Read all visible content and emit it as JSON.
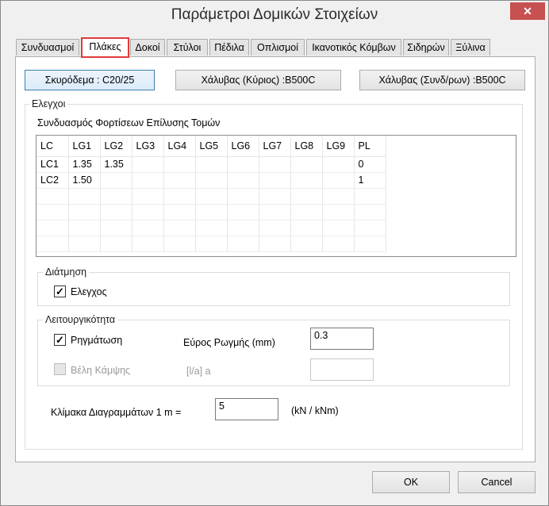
{
  "window": {
    "title": "Παράμετροι Δομικών Στοιχείων",
    "close_glyph": "✕"
  },
  "tabs": [
    {
      "label": "Συνδυασμοί"
    },
    {
      "label": "Πλάκες"
    },
    {
      "label": "Δοκοί"
    },
    {
      "label": "Στύλοι"
    },
    {
      "label": "Πέδιλα"
    },
    {
      "label": "Οπλισμοί"
    },
    {
      "label": "Ικανοτικός Κόμβων"
    },
    {
      "label": "Σιδηρών"
    },
    {
      "label": "Ξύλινα"
    }
  ],
  "active_tab": "Πλάκες",
  "materials": {
    "concrete": "Σκυρόδεμα : C20/25",
    "steel_main": "Χάλυβας  (Κύριος) :B500C",
    "steel_secondary": "Χάλυβας  (Συνδ/ρων) :B500C"
  },
  "checks": {
    "group_title": "Ελεγχοι",
    "combo_title": "Συνδυασμός Φορτίσεων Επίλυσης Τομών",
    "columns": [
      "LC",
      "LG1",
      "LG2",
      "LG3",
      "LG4",
      "LG5",
      "LG6",
      "LG7",
      "LG8",
      "LG9",
      "PL"
    ],
    "rows": [
      {
        "LC": "LC1",
        "LG1": "1.35",
        "LG2": "1.35",
        "LG3": "",
        "LG4": "",
        "LG5": "",
        "LG6": "",
        "LG7": "",
        "LG8": "",
        "LG9": "",
        "PL": "0"
      },
      {
        "LC": "LC2",
        "LG1": "1.50",
        "LG2": "",
        "LG3": "",
        "LG4": "",
        "LG5": "",
        "LG6": "",
        "LG7": "",
        "LG8": "",
        "LG9": "",
        "PL": "1"
      }
    ]
  },
  "punching": {
    "group_title": "Διάτμηση",
    "check_label": "Ελεγχος",
    "checked": true,
    "check_mark": "✓"
  },
  "serviceability": {
    "group_title": "Λειτουργικότητα",
    "cracking_label": "Ρηγμάτωση",
    "cracking_checked": true,
    "crack_width_label": "Εύρος Ρωγμής (mm)",
    "crack_width_value": "0.3",
    "deflection_label": "Βέλη Κάμψης",
    "deflection_checked": false,
    "deflection_ratio_label": "[l/a]  a",
    "deflection_ratio_value": ""
  },
  "scale": {
    "label": "Κλίμακα Διαγραμμάτων 1 m =",
    "value": "5",
    "unit": "(kN / kNm)"
  },
  "footer": {
    "ok_label": "OK",
    "cancel_label": "Cancel"
  }
}
